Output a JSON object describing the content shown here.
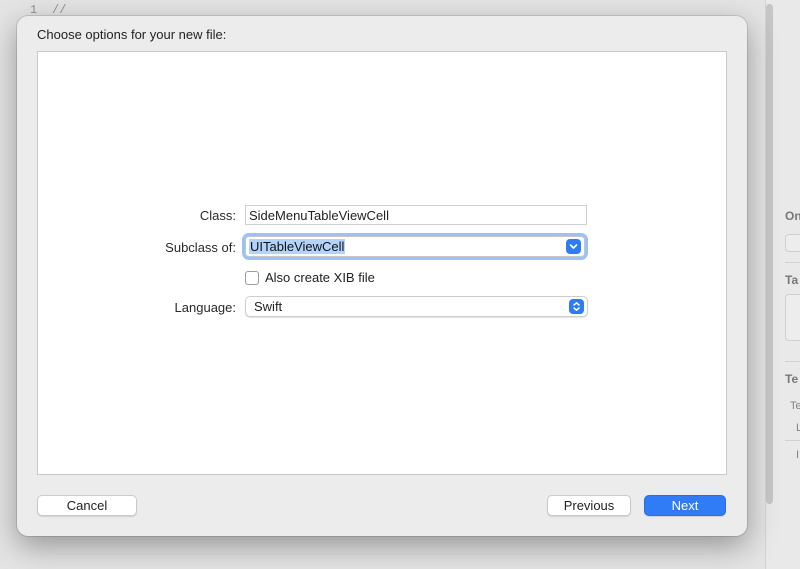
{
  "background": {
    "line_number": "1",
    "code": "//",
    "inspector_labels": [
      "On",
      "Ta",
      "Te",
      "Te",
      "L",
      "I"
    ]
  },
  "dialog": {
    "title": "Choose options for your new file:",
    "fields": {
      "class_label": "Class:",
      "class_value": "SideMenuTableViewCell",
      "subclass_label": "Subclass of:",
      "subclass_value": "UITableViewCell",
      "xib_label": "Also create XIB file",
      "xib_checked": false,
      "language_label": "Language:",
      "language_value": "Swift"
    },
    "buttons": {
      "cancel": "Cancel",
      "previous": "Previous",
      "next": "Next"
    }
  },
  "colors": {
    "accent": "#2f7cf6",
    "selection": "#b3d3fb"
  }
}
